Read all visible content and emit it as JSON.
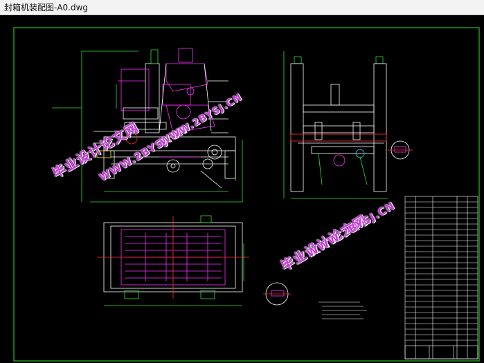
{
  "window": {
    "title": "封箱机装配图-A0.dwg"
  },
  "watermarks": {
    "cn_text": "毕业设计论文网",
    "url_text": "WWW.2BYSJ.CN",
    "color": "#c53bd8"
  },
  "colors": {
    "background": "#000000",
    "frame": "#2ee62e",
    "line": "#ffffff",
    "accent_magenta": "#ff30ff",
    "accent_red": "#ff3030",
    "accent_cyan": "#00e5ff",
    "accent_yellow": "#ffff40"
  }
}
